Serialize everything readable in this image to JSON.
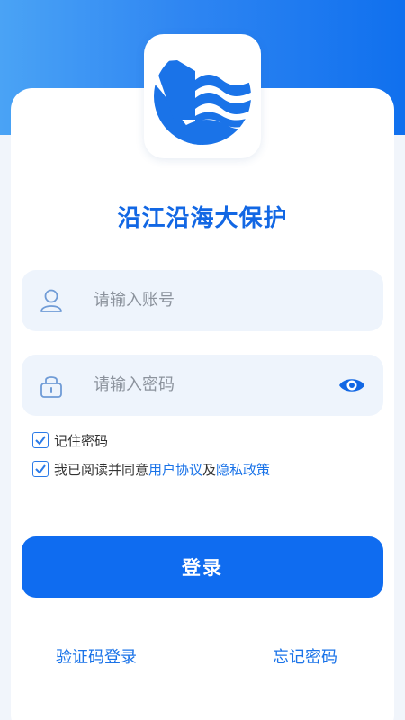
{
  "app": {
    "title": "沿江沿海大保护"
  },
  "colors": {
    "primary": "#0f6cf0",
    "title": "#1267e4",
    "field_bg": "#eef4fc",
    "header_gradient_start": "#4aa3f5",
    "header_gradient_end": "#1070ee"
  },
  "form": {
    "account_placeholder": "请输入账号",
    "password_placeholder": "请输入密码",
    "account_icon": "user-icon",
    "password_icon": "lock-icon",
    "eye_icon": "eye-icon"
  },
  "options": {
    "remember_label": "记住密码",
    "remember_checked": true,
    "agree_checked": true,
    "agree_prefix": "我已阅读并同意",
    "user_agreement": "用户协议",
    "and_text": "及",
    "privacy_policy": "隐私政策"
  },
  "actions": {
    "login_label": "登录",
    "sms_login": "验证码登录",
    "forgot_password": "忘记密码"
  }
}
